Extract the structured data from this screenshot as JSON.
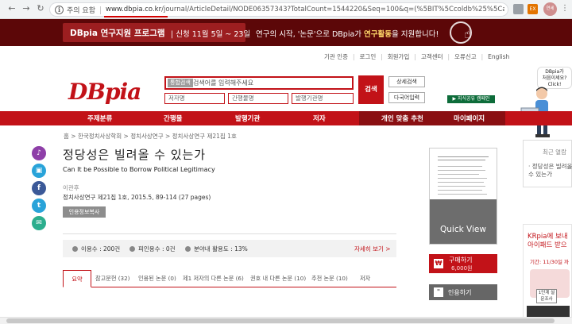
{
  "browser": {
    "security_label": "주의 요함",
    "url_domain": "www.dbpia.co.kr",
    "url_path": "/journal/ArticleDetail/NODE06357343?TotalCount=1544220&Seq=100&q=(%5BIT%5Ccoldb%25%5Ca%5D)&searc...",
    "extensions": [
      {
        "icon": "extension-icon-1",
        "label": ""
      },
      {
        "icon": "extension-icon-2",
        "label": ""
      },
      {
        "icon": "extension-icon-3",
        "label": "EX"
      },
      {
        "icon": "extension-icon-4",
        "label": ""
      }
    ],
    "profile_label": "연세"
  },
  "promo": {
    "title": "DBpia 연구지원 프로그램",
    "date": "| 신청 11월 5일 ~ 23일",
    "message_pre": "연구의 시작, '논문'으로 DBpia가 ",
    "message_highlight": "연구활동",
    "message_post": "을 지원합니다!"
  },
  "header": {
    "top_links": [
      "기관 인증",
      "로그인",
      "회원가입",
      "고객센터",
      "오류신고",
      "English"
    ],
    "logo": {
      "left": "DB",
      "right": "pia"
    },
    "search": {
      "tag": "통합검색",
      "placeholder": "검색어를 입력해주세요",
      "sub_inputs": [
        "저자명",
        "간행물명",
        "발행기관명"
      ],
      "button": "검색",
      "advanced": "상세검색",
      "multi": "다국어입력"
    },
    "campaign": "▶ 지식공유 캠페인"
  },
  "nav": [
    "주제분류",
    "간행물",
    "발행기관",
    "저자",
    "개인 맞춤 추천",
    "마이페이지"
  ],
  "mascot": {
    "bubble_line1": "DBpia가",
    "bubble_line2": "처음이세요?",
    "bubble_line3": "Click!"
  },
  "breadcrumb": "홈 > 한국정치사상학회 > 정치사상연구 > 정치사상연구 제21집 1호",
  "article": {
    "title_ko": "정당성은 빌려올 수 있는가",
    "title_en": "Can It be Possible to Borrow Political Legitimacy",
    "author": "이관후",
    "journal": "정치사상연구 제21집 1호, 2015.5, 89-114 (27 pages)",
    "cite_button": "인용정보복사",
    "stats": {
      "usage": "이용수 : 200건",
      "cited": "피인용수 : 0건",
      "field_usage": "분야내 활용도 : 13%",
      "more": "자세히 보기 >"
    },
    "tabs": [
      "요약",
      "참고문헌 (32)",
      "인용된 논문 (0)",
      "제1 저자의 다른 논문 (6)",
      "권호 내 다른 논문 (10)",
      "추천 논문 (10)",
      "저자"
    ]
  },
  "side_icons": [
    "bell-icon",
    "camera-icon",
    "facebook-icon",
    "twitter-icon",
    "mail-icon"
  ],
  "preview": {
    "quick_view": "Quick View"
  },
  "purchase": {
    "label": "구매하기",
    "price": "6,000원"
  },
  "quote": {
    "label": "인용하기"
  },
  "recent": {
    "title": "최근 열람",
    "item": "· 정당성은 빌려올 수 있는가"
  },
  "ad": {
    "line1": "KRpia에 보내",
    "line2": "아이패드 받으",
    "line3": "기간: 11/30일 까",
    "stamp": "1단계 설문조사",
    "button": ""
  }
}
